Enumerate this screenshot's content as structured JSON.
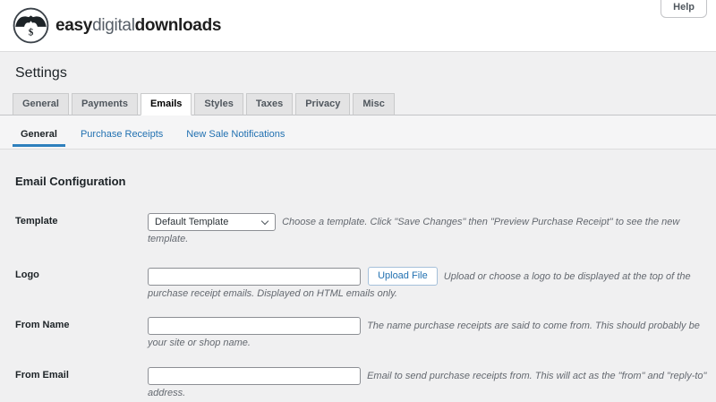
{
  "header": {
    "brand": {
      "easy": "easy",
      "digital": "digital",
      "downloads": "downloads"
    },
    "help_label": "Help"
  },
  "page": {
    "title": "Settings"
  },
  "tabs": [
    {
      "label": "General",
      "active": false
    },
    {
      "label": "Payments",
      "active": false
    },
    {
      "label": "Emails",
      "active": true
    },
    {
      "label": "Styles",
      "active": false
    },
    {
      "label": "Taxes",
      "active": false
    },
    {
      "label": "Privacy",
      "active": false
    },
    {
      "label": "Misc",
      "active": false
    }
  ],
  "subtabs": [
    {
      "label": "General",
      "active": true
    },
    {
      "label": "Purchase Receipts",
      "active": false
    },
    {
      "label": "New Sale Notifications",
      "active": false
    }
  ],
  "section": {
    "title": "Email Configuration"
  },
  "form": {
    "rows": [
      {
        "label": "Template",
        "type": "select",
        "value": "Default Template",
        "description": "Choose a template. Click \"Save Changes\" then \"Preview Purchase Receipt\" to see the new template."
      },
      {
        "label": "Logo",
        "type": "input-upload",
        "value": "",
        "button": "Upload File",
        "description": "Upload or choose a logo to be displayed at the top of the purchase receipt emails. Displayed on HTML emails only."
      },
      {
        "label": "From Name",
        "type": "input",
        "value": "",
        "description": "The name purchase receipts are said to come from. This should probably be your site or shop name."
      },
      {
        "label": "From Email",
        "type": "input",
        "value": "",
        "description": "Email to send purchase receipts from. This will act as the \"from\" and \"reply-to\" address."
      }
    ]
  },
  "colors": {
    "accent_blue": "#2271b1",
    "subtab_underline": "#2e80bd",
    "page_background": "#f0f0f1",
    "header_background": "#ffffff",
    "tab_inactive_background": "#e3e3e4",
    "border_gray": "#c3c4c7",
    "description_gray": "#646970"
  }
}
